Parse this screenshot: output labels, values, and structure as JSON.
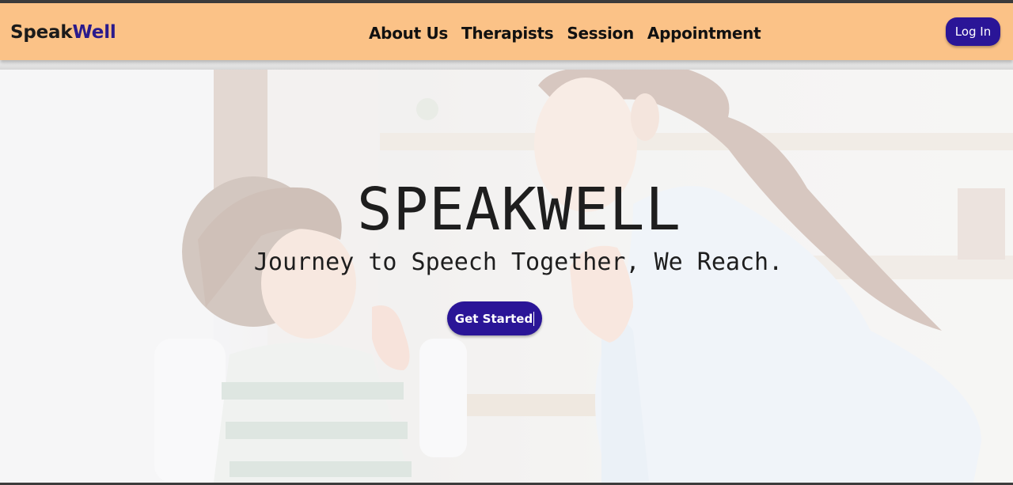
{
  "navbar": {
    "brand_part1": "Speak",
    "brand_part2": "Well",
    "links": [
      "About Us",
      "Therapists",
      "Session",
      "Appointment"
    ],
    "login_label": "Log In"
  },
  "hero": {
    "title": "SPEAKWELL",
    "subtitle": "Journey to Speech Together, We Reach.",
    "cta_label": "Get Started",
    "image_alt": "woman-and-child-speech-therapy-photo"
  },
  "colors": {
    "navbar_bg": "#fbc287",
    "accent": "#2a1597",
    "brand_dark": "#1b1b1b"
  }
}
